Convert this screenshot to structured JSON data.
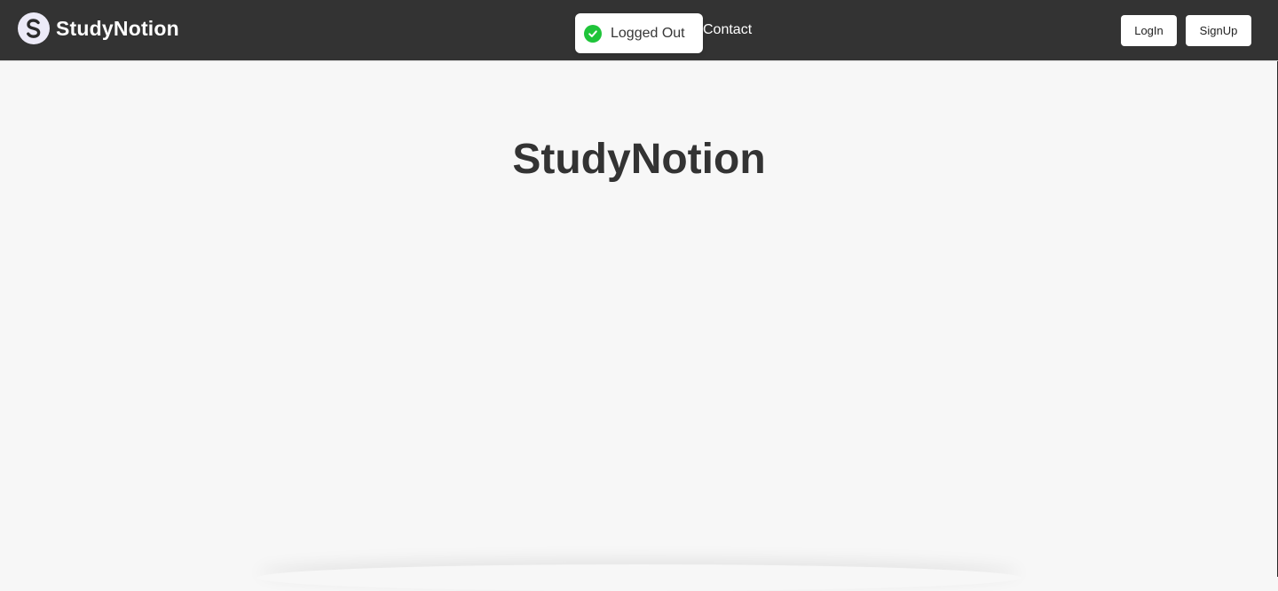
{
  "brand": {
    "name": "StudyNotion",
    "logo_icon": "logo-s-icon"
  },
  "nav": {
    "links": [
      {
        "label": "Contact"
      }
    ]
  },
  "auth": {
    "login_label": "LogIn",
    "signup_label": "SignUp"
  },
  "toast": {
    "message": "Logged Out",
    "icon": "check-circle-icon",
    "icon_color": "#1fc43a"
  },
  "hero": {
    "title": "StudyNotion"
  },
  "colors": {
    "navbar": "#333333",
    "page_background": "#f7f7f7",
    "title_text": "#333333"
  }
}
